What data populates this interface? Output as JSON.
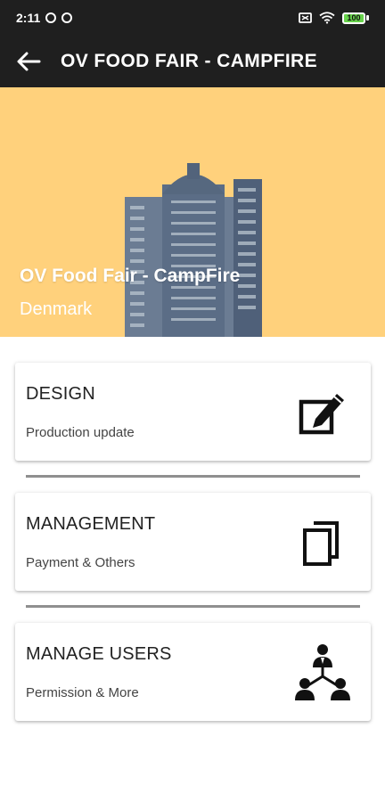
{
  "status_bar": {
    "time": "2:11",
    "battery": "100"
  },
  "app_bar": {
    "title": "OV FOOD FAIR - CAMPFIRE",
    "back_icon": "arrow-left-icon"
  },
  "banner": {
    "title": "OV Food Fair - CampFire",
    "subtitle": "Denmark",
    "background_color": "#ffd17c"
  },
  "cards": [
    {
      "title": "DESIGN",
      "subtitle": "Production update",
      "icon": "edit-icon"
    },
    {
      "title": "MANAGEMENT",
      "subtitle": "Payment & Others",
      "icon": "copy-documents-icon"
    },
    {
      "title": "MANAGE USERS",
      "subtitle": "Permission & More",
      "icon": "users-network-icon"
    }
  ]
}
